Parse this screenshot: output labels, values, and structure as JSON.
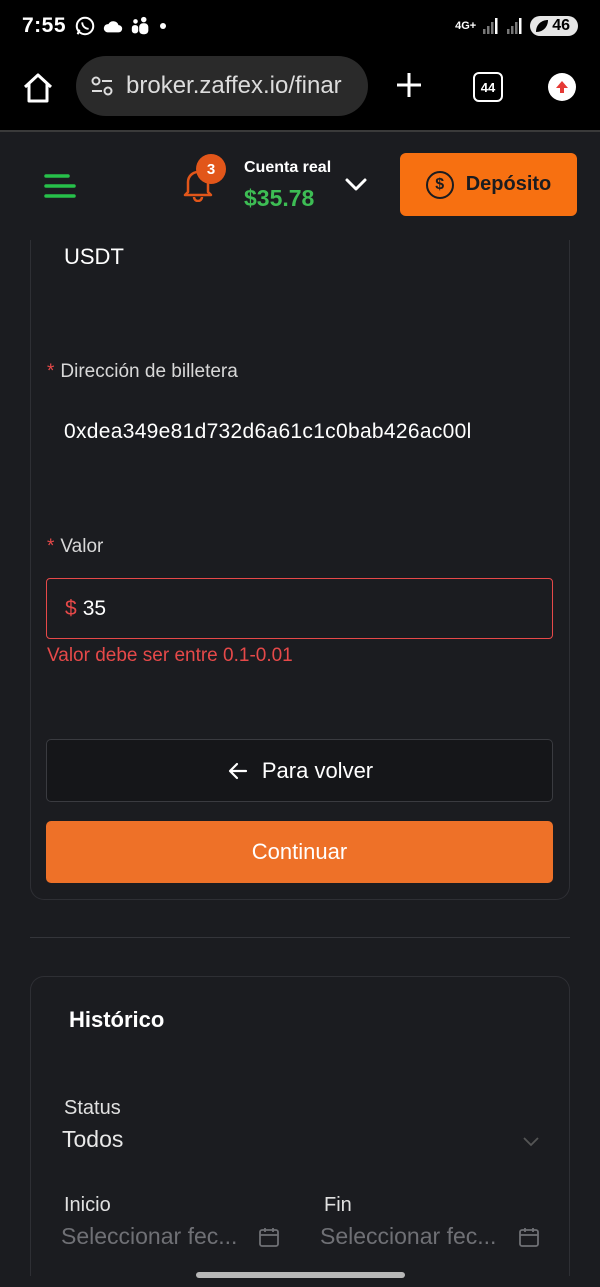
{
  "status_bar": {
    "time": "7:55",
    "network": "4G+",
    "battery": "46"
  },
  "browser": {
    "url": "broker.zaffex.io/finar",
    "tab_count": "44"
  },
  "header": {
    "notifications_count": "3",
    "account_label": "Cuenta real",
    "account_balance": "$35.78",
    "deposit_label": "Depósito"
  },
  "form": {
    "currency_value": "USDT",
    "wallet_label": "Dirección de billetera",
    "wallet_value": "0xdea349e81d732d6a61c1c0bab426ac00l",
    "required_mark": "*",
    "value_label": "Valor",
    "value_currency": "$",
    "value_amount": "35",
    "error_message": "Valor debe ser entre 0.1-0.01",
    "back_label": "Para volver",
    "continue_label": "Continuar"
  },
  "history": {
    "title": "Histórico",
    "status_label": "Status",
    "status_value": "Todos",
    "start_label": "Inicio",
    "start_placeholder": "Seleccionar fec...",
    "end_label": "Fin",
    "end_placeholder": "Seleccionar fec..."
  },
  "colors": {
    "accent_orange": "#f77011",
    "balance_green": "#3dbd54",
    "error_red": "#e64949",
    "background": "#1b1c20"
  }
}
